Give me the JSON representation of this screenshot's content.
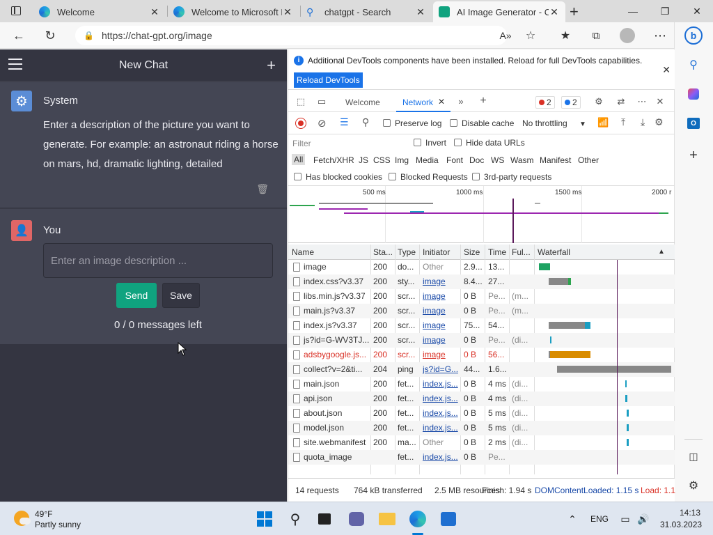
{
  "browser": {
    "tabs": [
      {
        "title": "Welcome",
        "favicon": "edge-icon"
      },
      {
        "title": "Welcome to Microsoft E",
        "favicon": "edge-icon"
      },
      {
        "title": "chatgpt - Search",
        "favicon": "search-icon"
      },
      {
        "title": "AI Image Generator - C",
        "favicon": "robot-icon"
      }
    ],
    "url": "https://chat-gpt.org/image"
  },
  "chat": {
    "header_title": "New Chat",
    "system_name": "System",
    "system_text": "Enter a description of the picture you want to generate. For example: an astronaut riding a horse on mars, hd, dramatic lighting, detailed",
    "user_name": "You",
    "input_placeholder": "Enter an image description ...",
    "send_label": "Send",
    "save_label": "Save",
    "messages_left": "0 / 0 messages left"
  },
  "devtools": {
    "info_text": "Additional DevTools components have been installed. Reload for full DevTools capabilities.",
    "reload_label": "Reload DevTools",
    "tabs": {
      "welcome": "Welcome",
      "network": "Network"
    },
    "errors_count": "2",
    "issues_count": "2",
    "toolbar": {
      "preserve_log": "Preserve log",
      "disable_cache": "Disable cache",
      "throttling": "No throttling"
    },
    "filter_placeholder": "Filter",
    "invert": "Invert",
    "hide_data_urls": "Hide data URLs",
    "types": [
      "All",
      "Fetch/XHR",
      "JS",
      "CSS",
      "Img",
      "Media",
      "Font",
      "Doc",
      "WS",
      "Wasm",
      "Manifest",
      "Other"
    ],
    "has_blocked_cookies": "Has blocked cookies",
    "blocked_requests": "Blocked Requests",
    "third_party": "3rd-party requests",
    "overview_ticks": [
      "500 ms",
      "1000 ms",
      "1500 ms",
      "2000 r"
    ],
    "columns": [
      "Name",
      "Sta...",
      "Type",
      "Initiator",
      "Size",
      "Time",
      "Ful...",
      "Waterfall"
    ],
    "rows": [
      {
        "name": "image",
        "status": "200",
        "type": "do...",
        "initiator": "Other",
        "size": "2.9...",
        "time": "13...",
        "ful": ""
      },
      {
        "name": "index.css?v3.37",
        "status": "200",
        "type": "sty...",
        "initiator": "image",
        "size": "8.4...",
        "time": "27...",
        "ful": ""
      },
      {
        "name": "libs.min.js?v3.37",
        "status": "200",
        "type": "scr...",
        "initiator": "image",
        "size": "0 B",
        "time": "Pe...",
        "ful": "(m..."
      },
      {
        "name": "main.js?v3.37",
        "status": "200",
        "type": "scr...",
        "initiator": "image",
        "size": "0 B",
        "time": "Pe...",
        "ful": "(m..."
      },
      {
        "name": "index.js?v3.37",
        "status": "200",
        "type": "scr...",
        "initiator": "image",
        "size": "75...",
        "time": "54...",
        "ful": ""
      },
      {
        "name": "js?id=G-WV3TJ...",
        "status": "200",
        "type": "scr...",
        "initiator": "image",
        "size": "0 B",
        "time": "Pe...",
        "ful": "(di..."
      },
      {
        "name": "adsbygoogle.js...",
        "status": "200",
        "type": "scr...",
        "initiator": "image",
        "size": "0 B",
        "time": "56...",
        "ful": ""
      },
      {
        "name": "collect?v=2&ti...",
        "status": "204",
        "type": "ping",
        "initiator": "js?id=G...",
        "size": "44...",
        "time": "1.6...",
        "ful": ""
      },
      {
        "name": "main.json",
        "status": "200",
        "type": "fet...",
        "initiator": "index.js...",
        "size": "0 B",
        "time": "4 ms",
        "ful": "(di..."
      },
      {
        "name": "api.json",
        "status": "200",
        "type": "fet...",
        "initiator": "index.js...",
        "size": "0 B",
        "time": "4 ms",
        "ful": "(di..."
      },
      {
        "name": "about.json",
        "status": "200",
        "type": "fet...",
        "initiator": "index.js...",
        "size": "0 B",
        "time": "5 ms",
        "ful": "(di..."
      },
      {
        "name": "model.json",
        "status": "200",
        "type": "fet...",
        "initiator": "index.js...",
        "size": "0 B",
        "time": "5 ms",
        "ful": "(di..."
      },
      {
        "name": "site.webmanifest",
        "status": "200",
        "type": "ma...",
        "initiator": "Other",
        "size": "0 B",
        "time": "2 ms",
        "ful": "(di..."
      },
      {
        "name": "quota_image",
        "status": "",
        "type": "fet...",
        "initiator": "index.js...",
        "size": "0 B",
        "time": "Pe...",
        "ful": ""
      }
    ],
    "status": {
      "requests": "14 requests",
      "transferred": "764 kB transferred",
      "resources": "2.5 MB resources",
      "finish": "Finish: 1.94 s",
      "dcl": "DOMContentLoaded: 1.15 s",
      "load": "Load: 1.1"
    }
  },
  "taskbar": {
    "temperature": "49°F",
    "weather": "Partly sunny",
    "language": "ENG",
    "time": "14:13",
    "date": "31.03.2023"
  }
}
